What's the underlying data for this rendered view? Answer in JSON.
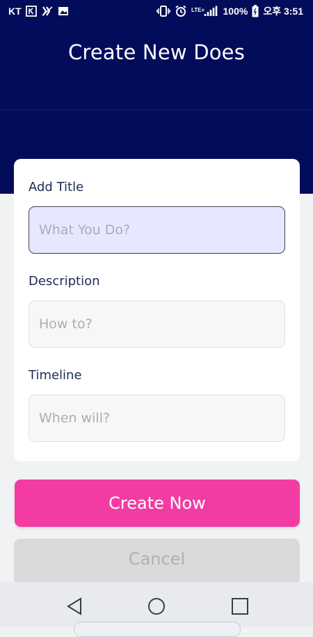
{
  "status_bar": {
    "carrier": "KT",
    "battery": "100%",
    "time": "오후 3:51",
    "network": "LTE+"
  },
  "header": {
    "title": "Create New Does"
  },
  "form": {
    "title_label": "Add Title",
    "title_placeholder": "What You Do?",
    "description_label": "Description",
    "description_placeholder": "How to?",
    "timeline_label": "Timeline",
    "timeline_placeholder": "When will?"
  },
  "actions": {
    "create_label": "Create Now",
    "cancel_label": "Cancel"
  },
  "colors": {
    "header_bg": "#020c5a",
    "primary_button": "#f23ca3",
    "cancel_button": "#dadadb",
    "focused_input": "#e6e8ff"
  },
  "icons": {
    "nav_back": "back-triangle-icon",
    "nav_home": "home-circle-icon",
    "nav_recents": "recents-square-icon"
  }
}
